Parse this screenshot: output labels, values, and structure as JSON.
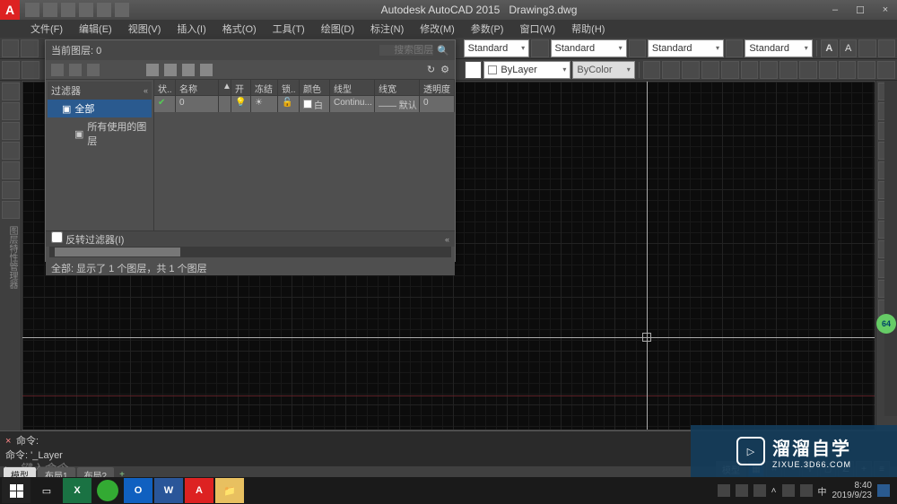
{
  "title": {
    "app": "Autodesk AutoCAD 2015",
    "doc": "Drawing3.dwg"
  },
  "menu": [
    "文件(F)",
    "编辑(E)",
    "视图(V)",
    "插入(I)",
    "格式(O)",
    "工具(T)",
    "绘图(D)",
    "标注(N)",
    "修改(M)",
    "参数(P)",
    "窗口(W)",
    "帮助(H)"
  ],
  "dropdowns": {
    "std1": "Standard",
    "std2": "Standard",
    "std3": "Standard",
    "std4": "Standard",
    "bylayer": "ByLayer",
    "bycolor": "ByColor"
  },
  "layerPanel": {
    "currentLayerLabel": "当前图层: 0",
    "searchPlaceholder": "搜索图层",
    "filterHeader": "过滤器",
    "tree": {
      "root": "全部",
      "child": "所有使用的图层"
    },
    "cols": [
      "状..",
      "名称",
      "▲",
      "开",
      "冻结",
      "锁..",
      "颜色",
      "线型",
      "线宽",
      "透明度"
    ],
    "row": {
      "name": "0",
      "open": "💡",
      "freeze": "☀",
      "lock": "🔓",
      "colorLabel": "白",
      "ltype": "Continu...",
      "lweight": "—— 默认",
      "trans": "0"
    },
    "invert": "反转过滤器(I)",
    "footer": "全部: 显示了 1 个图层，共 1 个图层"
  },
  "cmd": {
    "label": "命令:",
    "last": "命令: '_Layer",
    "placeholder": "键入命令"
  },
  "tabs": {
    "model": "模型",
    "layout1": "布局1",
    "layout2": "布局2"
  },
  "status": {
    "model": "模型"
  },
  "watermark": {
    "big": "溜溜自学",
    "small": "ZIXUE.3D66.COM"
  },
  "taskbar": {
    "time": "8:40",
    "date": "2019/9/23"
  },
  "badge": "64",
  "icons": {
    "search": "🔍",
    "gear": "⚙",
    "refresh": "↻",
    "close": "×",
    "min": "–",
    "max": "☐",
    "play": "▷",
    "chev_dbl": "«",
    "chev_r": "»"
  }
}
